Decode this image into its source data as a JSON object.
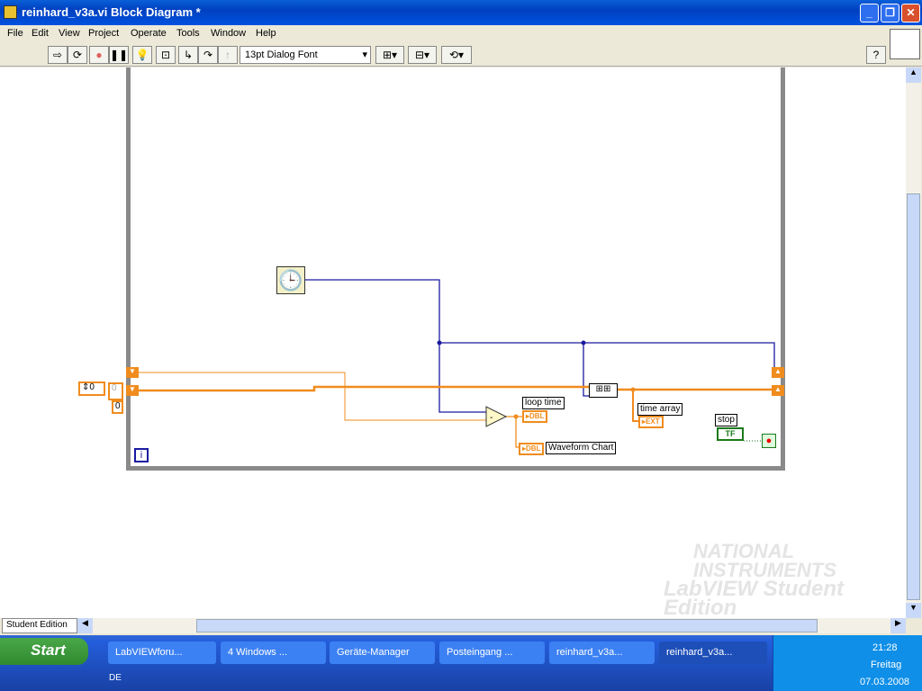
{
  "window": {
    "title": "reinhard_v3a.vi Block Diagram *",
    "min": "_",
    "max": "❐",
    "close": "✕"
  },
  "menu": [
    "File",
    "Edit",
    "View",
    "Project",
    "Operate",
    "Tools",
    "Window",
    "Help"
  ],
  "toolbar": {
    "font": "13pt Dialog Font",
    "help": "?"
  },
  "diagram": {
    "const1": "0",
    "const2": "0",
    "const3": "0",
    "loop_time": "loop time",
    "dbl": "DBL",
    "waveform_chart": "Waveform Chart",
    "time_array": "time array",
    "ext": "EXT",
    "stop": "stop",
    "tf": "TF",
    "iteration": "i"
  },
  "status": {
    "edition": "Student Edition"
  },
  "watermark": {
    "line1": "NATIONAL",
    "line2": "INSTRUMENTS",
    "line3": "LabVIEW Student Edition"
  },
  "taskbar": {
    "start": "Start",
    "tasks": [
      "LabVIEWforu...",
      "4 Windows ...",
      "Geräte-Manager",
      "Posteingang ...",
      "reinhard_v3a...",
      "reinhard_v3a..."
    ],
    "lang": "DE",
    "time": "21:28",
    "day": "Freitag",
    "date": "07.03.2008"
  },
  "colors": {
    "wire_orange": "#f08c1e",
    "wire_blue": "#1a1aa0"
  }
}
